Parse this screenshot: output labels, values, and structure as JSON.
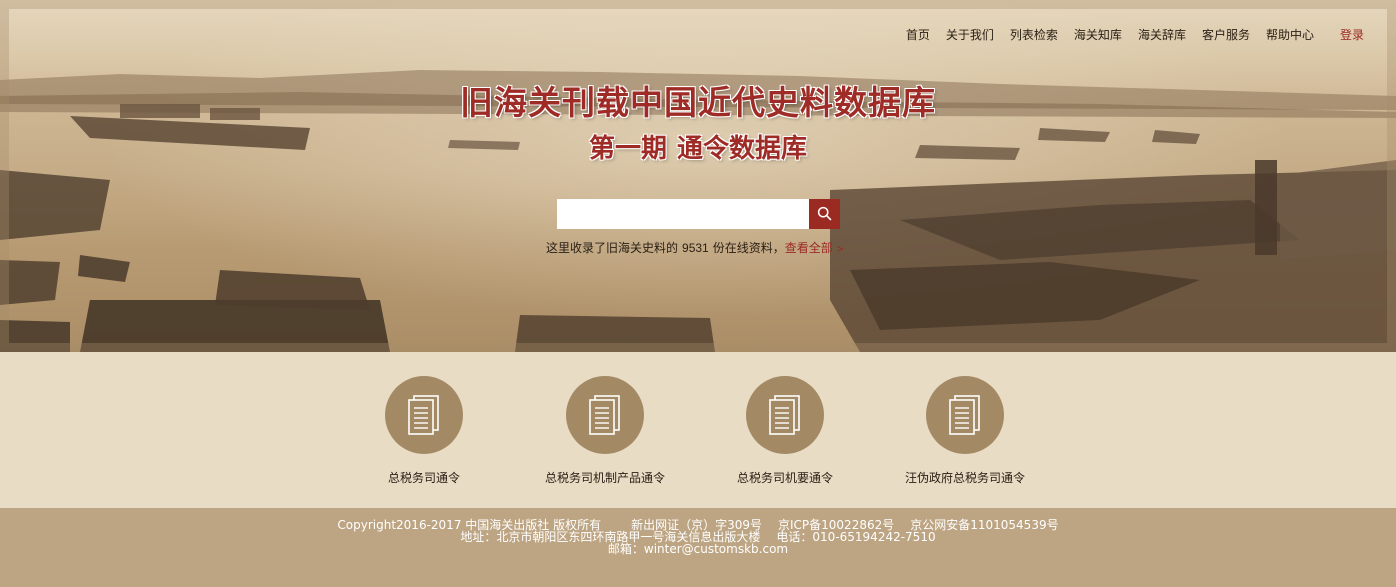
{
  "nav": {
    "items": [
      "首页",
      "关于我们",
      "列表检索",
      "海关知库",
      "海关辞库",
      "客户服务",
      "帮助中心"
    ],
    "login": "登录"
  },
  "hero": {
    "title": "旧海关刊载中国近代史料数据库",
    "subtitle_part1": "第一期",
    "subtitle_part2": "通令数据库"
  },
  "search": {
    "placeholder": "",
    "note_prefix": "这里收录了旧海关史料的",
    "count": "9531",
    "note_suffix": "份在线资料，",
    "view_all": "查看全部",
    "arrow": ">"
  },
  "categories": [
    {
      "label": "总税务司通令",
      "icon": "document-icon"
    },
    {
      "label": "总税务司机制产品通令",
      "icon": "document-icon"
    },
    {
      "label": "总税务司机要通令",
      "icon": "document-icon"
    },
    {
      "label": "汪伪政府总税务司通令",
      "icon": "document-icon"
    }
  ],
  "footer": {
    "copyright": "Copyright2016-2017 中国海关出版社 版权所有",
    "license": "新出网证（京）字309号",
    "icp": "京ICP备10022862号",
    "police": "京公网安备1101054539号",
    "address": "地址：北京市朝阳区东四环南路甲一号海关信息出版大楼",
    "phone": "电话：010-65194242-7510",
    "email": "邮箱：winter@customskb.com"
  },
  "colors": {
    "accent": "#9b2a23",
    "circle": "#a38a65",
    "band": "#e9dcc5",
    "footer": "#bda583"
  }
}
